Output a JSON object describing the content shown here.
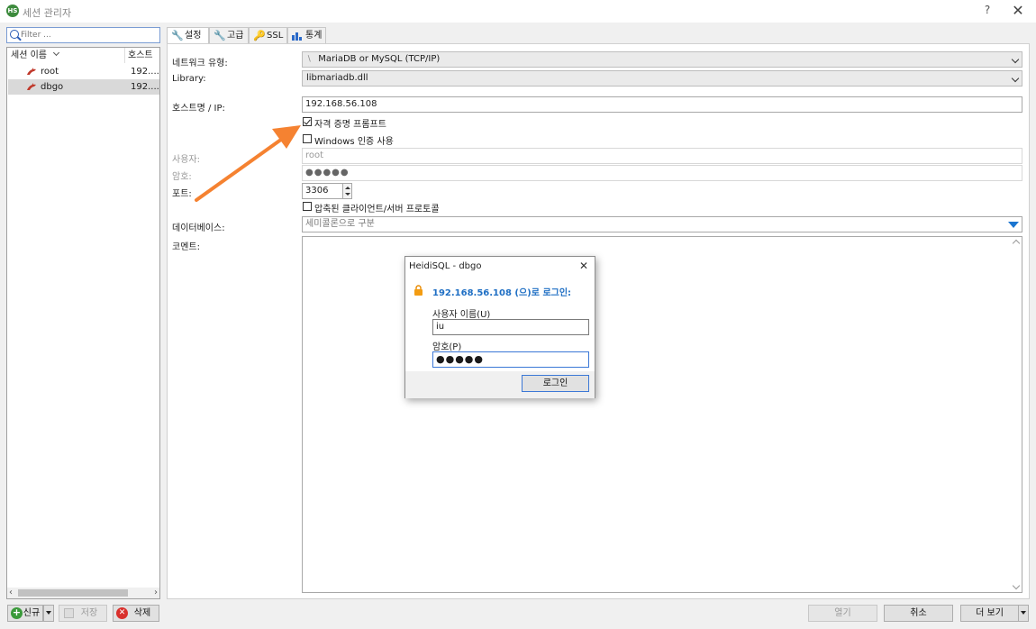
{
  "window": {
    "title": "세션 관리자",
    "help": "?",
    "close": "✕",
    "app_icon": "HS"
  },
  "filter": {
    "placeholder": "Filter ..."
  },
  "tree": {
    "col_name": "세션 이름",
    "col_host": "호스트",
    "rows": [
      {
        "name": "root",
        "host": "192...."
      },
      {
        "name": "dbgo",
        "host": "192...."
      }
    ]
  },
  "tabs": [
    {
      "label": "설정",
      "icon": "wrench-icon"
    },
    {
      "label": "고급",
      "icon": "wrench-icon"
    },
    {
      "label": "SSL",
      "icon": "key-icon"
    },
    {
      "label": "통계",
      "icon": "bar-chart-icon"
    }
  ],
  "settings": {
    "network_type_label": "네트워크 유형:",
    "network_type_value": "MariaDB or MySQL (TCP/IP)",
    "library_label": "Library:",
    "library_value": "libmariadb.dll",
    "host_label": "호스트명 / IP:",
    "host_value": "192.168.56.108",
    "prompt_credentials": "자격 증명 프롬프트",
    "prompt_credentials_checked": true,
    "windows_auth": "Windows 인증 사용",
    "windows_auth_checked": false,
    "user_label": "사용자:",
    "user_value": "root",
    "password_label": "암호:",
    "password_value": "●●●●●",
    "port_label": "포트:",
    "port_value": "3306",
    "compress": "압축된 클라이언트/서버 프로토콜",
    "compress_checked": false,
    "database_label": "데이터베이스:",
    "database_placeholder": "세미콜론으로 구분",
    "comment_label": "코멘트:"
  },
  "bottom": {
    "new": "신규",
    "save": "저장",
    "delete": "삭제",
    "open": "열기",
    "cancel": "취소",
    "more": "더 보기"
  },
  "dialog": {
    "title": "HeidiSQL - dbgo",
    "heading": "192.168.56.108 (으)로 로그인:",
    "username_label": "사용자 이름(U)",
    "username_value": "iu",
    "password_label": "암호(P)",
    "password_value": "●●●●●",
    "login": "로그인",
    "close": "✕"
  },
  "colors": {
    "accent": "#1b75d0",
    "heading": "#1f6fc4",
    "annotation_arrow": "#f58231",
    "dolphin": "#c0392b"
  }
}
